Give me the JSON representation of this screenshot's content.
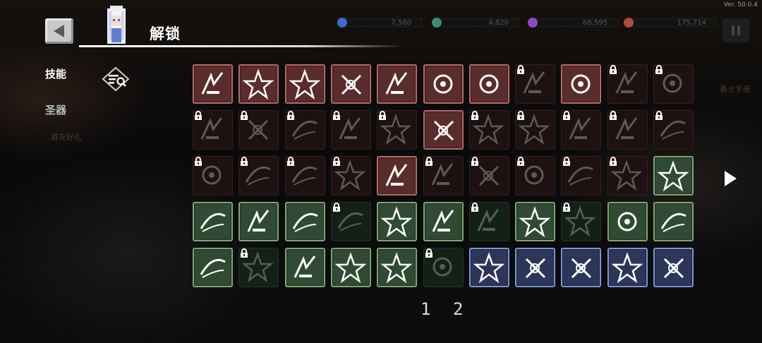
{
  "version": "Ver. 50.0.4",
  "title": "解锁",
  "currencies": [
    {
      "icon": "blue-gem-icon",
      "value": "7,580",
      "color": "#3b6cc9"
    },
    {
      "icon": "green-orb-icon",
      "value": "4,820",
      "color": "#3d8a7a"
    },
    {
      "icon": "purple-crystal-icon",
      "value": "68,595",
      "color": "#8a4cc2"
    },
    {
      "icon": "red-ore-icon",
      "value": "175,714",
      "color": "#b04a3a"
    }
  ],
  "sidebar": {
    "tabs": [
      {
        "label": "技能",
        "active": true
      },
      {
        "label": "圣器",
        "active": false
      }
    ]
  },
  "background_labels": {
    "left_promo": "首充好礼",
    "right_manual": "勇士手册"
  },
  "grid": {
    "columns": 11,
    "rows": [
      [
        {
          "icon": "slash-arc-icon",
          "color": "red",
          "locked": false
        },
        {
          "icon": "blade-swing-icon",
          "color": "red",
          "locked": false
        },
        {
          "icon": "burst-flame-icon",
          "color": "red",
          "locked": false
        },
        {
          "icon": "radial-burst-icon",
          "color": "red",
          "locked": false
        },
        {
          "icon": "arrows-up-down-icon",
          "color": "red",
          "locked": false
        },
        {
          "icon": "snowflake-orb-icon",
          "color": "red",
          "locked": false
        },
        {
          "icon": "fire-orb-icon",
          "color": "red",
          "locked": false
        },
        {
          "icon": "dark-ring-icon",
          "color": "red",
          "locked": true
        },
        {
          "icon": "triple-arrows-icon",
          "color": "red",
          "locked": false
        },
        {
          "icon": "biohazard-icon",
          "color": "red",
          "locked": true
        },
        {
          "icon": "crescent-claw-icon",
          "color": "red",
          "locked": true
        }
      ],
      [
        {
          "icon": "wind-dash-icon",
          "color": "red",
          "locked": true
        },
        {
          "icon": "feather-icon",
          "color": "red",
          "locked": true
        },
        {
          "icon": "star-spark-icon",
          "color": "red",
          "locked": true
        },
        {
          "icon": "crossed-swords-icon",
          "color": "red",
          "locked": true
        },
        {
          "icon": "spiral-icon",
          "color": "red",
          "locked": true
        },
        {
          "icon": "target-rings-icon",
          "color": "red",
          "locked": false
        },
        {
          "icon": "streak-icon",
          "color": "red",
          "locked": true
        },
        {
          "icon": "smoke-cloud-icon",
          "color": "red",
          "locked": true
        },
        {
          "icon": "fist-icon",
          "color": "red",
          "locked": true
        },
        {
          "icon": "eye-orbit-icon",
          "color": "red",
          "locked": true
        },
        {
          "icon": "claw-slash-icon",
          "color": "red",
          "locked": true
        }
      ],
      [
        {
          "icon": "lightning-orb-icon",
          "color": "red",
          "locked": true
        },
        {
          "icon": "comet-icon",
          "color": "red",
          "locked": true
        },
        {
          "icon": "spear-icon",
          "color": "red",
          "locked": true
        },
        {
          "icon": "cross-slash-icon",
          "color": "red",
          "locked": true
        },
        {
          "icon": "shockwave-icon",
          "color": "red",
          "locked": false
        },
        {
          "icon": "fire-ball-icon",
          "color": "red",
          "locked": true
        },
        {
          "icon": "grass-spikes-icon",
          "color": "red",
          "locked": true
        },
        {
          "icon": "fang-jaw-icon",
          "color": "red",
          "locked": true
        },
        {
          "icon": "flame-wall-icon",
          "color": "red",
          "locked": true
        },
        {
          "icon": "vortex-star-icon",
          "color": "red",
          "locked": true
        },
        {
          "icon": "ground-slam-icon",
          "color": "green",
          "locked": false
        }
      ],
      [
        {
          "icon": "chain-link-icon",
          "color": "green",
          "locked": false
        },
        {
          "icon": "lightning-bolt-icon",
          "color": "green",
          "locked": false
        },
        {
          "icon": "totem-icon",
          "color": "green",
          "locked": false
        },
        {
          "icon": "blast-icon",
          "color": "green",
          "locked": true
        },
        {
          "icon": "skull-burst-icon",
          "color": "green",
          "locked": false
        },
        {
          "icon": "biohazard-icon",
          "color": "green",
          "locked": false
        },
        {
          "icon": "beam-icon",
          "color": "green",
          "locked": true
        },
        {
          "icon": "potion-icon",
          "color": "green",
          "locked": false
        },
        {
          "icon": "scythe-icon",
          "color": "green",
          "locked": true
        },
        {
          "icon": "triple-swords-icon",
          "color": "green",
          "locked": false
        },
        {
          "icon": "crack-icon",
          "color": "green",
          "locked": false
        }
      ],
      [
        {
          "icon": "dust-cloud-icon",
          "color": "green",
          "locked": false
        },
        {
          "icon": "claw-strike-icon",
          "color": "green",
          "locked": true
        },
        {
          "icon": "whirlwind-icon",
          "color": "green",
          "locked": false
        },
        {
          "icon": "lightning-streak-icon",
          "color": "green",
          "locked": false
        },
        {
          "icon": "splash-icon",
          "color": "green",
          "locked": false
        },
        {
          "icon": "gauntlet-icon",
          "color": "green",
          "locked": true
        },
        {
          "icon": "armored-orb-icon",
          "color": "blue",
          "locked": false
        },
        {
          "icon": "flame-spirit-icon",
          "color": "blue",
          "locked": false
        },
        {
          "icon": "hourglass-up-icon",
          "color": "blue",
          "locked": false
        },
        {
          "icon": "speed-boost-icon",
          "color": "blue",
          "locked": false
        },
        {
          "icon": "dash-up-icon",
          "color": "blue",
          "locked": false
        }
      ]
    ]
  },
  "pages": [
    "1",
    "2"
  ],
  "colors": {
    "red_frame": "#b46a6a",
    "green_frame": "#7ea773",
    "blue_frame": "#7e95d8"
  }
}
